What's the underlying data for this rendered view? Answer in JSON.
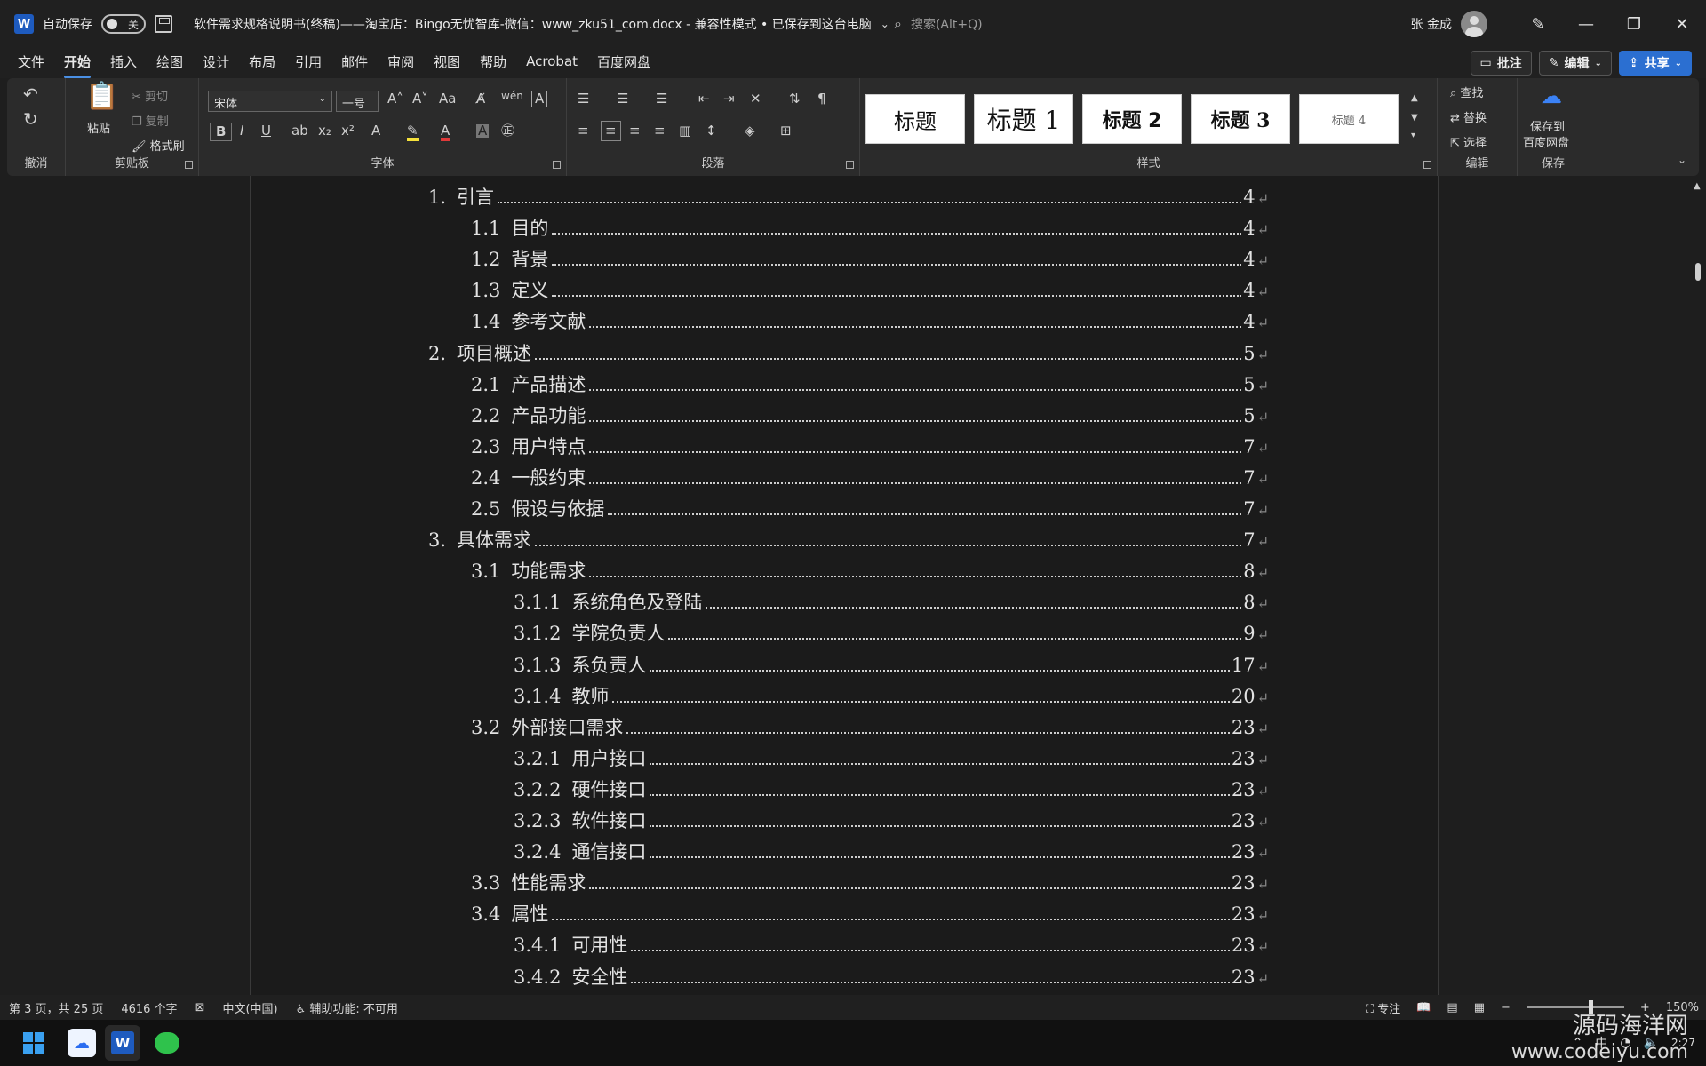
{
  "titlebar": {
    "autosave_label": "自动保存",
    "toggle_state": "关",
    "doc_title": "软件需求规格说明书(终稿)——淘宝店：Bingo无忧智库-微信：www_zku51_com.docx  -  兼容性模式 • 已保存到这台电脑",
    "search_placeholder": "搜索(Alt+Q)",
    "user_name": "张 金成"
  },
  "menu": {
    "tabs": [
      "文件",
      "开始",
      "插入",
      "绘图",
      "设计",
      "布局",
      "引用",
      "邮件",
      "审阅",
      "视图",
      "帮助",
      "Acrobat",
      "百度网盘"
    ],
    "active_tab": "开始",
    "comment_btn": "批注",
    "edit_btn": "编辑",
    "share_btn": "共享"
  },
  "ribbon": {
    "undo_label": "撤消",
    "clipboard": {
      "paste": "粘贴",
      "cut": "剪切",
      "copy": "复制",
      "format_painter": "格式刷",
      "label": "剪贴板"
    },
    "font": {
      "name": "宋体",
      "size": "一号",
      "label": "字体"
    },
    "paragraph_label": "段落",
    "styles": {
      "label": "样式",
      "items": [
        "标题",
        "标题 1",
        "标题 2",
        "标题 3",
        "标题 4"
      ]
    },
    "editing": {
      "find": "查找",
      "replace": "替换",
      "select": "选择",
      "label": "编辑"
    },
    "save": {
      "line1": "保存到",
      "line2": "百度网盘",
      "label": "保存"
    }
  },
  "toc": [
    {
      "num": "1.",
      "text": "引言",
      "page": "4",
      "level": 1
    },
    {
      "num": "1.1",
      "text": "目的",
      "page": "4",
      "level": 2
    },
    {
      "num": "1.2",
      "text": "背景",
      "page": "4",
      "level": 2
    },
    {
      "num": "1.3",
      "text": "定义",
      "page": "4",
      "level": 2
    },
    {
      "num": "1.4",
      "text": "参考文献",
      "page": "4",
      "level": 2
    },
    {
      "num": "2.",
      "text": "项目概述",
      "page": "5",
      "level": 1
    },
    {
      "num": "2.1",
      "text": "产品描述",
      "page": "5",
      "level": 2
    },
    {
      "num": "2.2",
      "text": "产品功能",
      "page": "5",
      "level": 2
    },
    {
      "num": "2.3",
      "text": "用户特点",
      "page": "7",
      "level": 2
    },
    {
      "num": "2.4",
      "text": "一般约束",
      "page": "7",
      "level": 2
    },
    {
      "num": "2.5",
      "text": "假设与依据",
      "page": "7",
      "level": 2
    },
    {
      "num": "3.",
      "text": "具体需求",
      "page": "7",
      "level": 1
    },
    {
      "num": "3.1",
      "text": "功能需求",
      "page": "8",
      "level": 2
    },
    {
      "num": "3.1.1",
      "text": "系统角色及登陆",
      "page": "8",
      "level": 3
    },
    {
      "num": "3.1.2",
      "text": "学院负责人",
      "page": "9",
      "level": 3
    },
    {
      "num": "3.1.3",
      "text": "系负责人",
      "page": "17",
      "level": 3
    },
    {
      "num": "3.1.4",
      "text": "教师",
      "page": "20",
      "level": 3
    },
    {
      "num": "3.2",
      "text": "外部接口需求",
      "page": "23",
      "level": 2
    },
    {
      "num": "3.2.1",
      "text": "用户接口",
      "page": "23",
      "level": 3
    },
    {
      "num": "3.2.2",
      "text": "硬件接口",
      "page": "23",
      "level": 3
    },
    {
      "num": "3.2.3",
      "text": "软件接口",
      "page": "23",
      "level": 3
    },
    {
      "num": "3.2.4",
      "text": "通信接口",
      "page": "23",
      "level": 3
    },
    {
      "num": "3.3",
      "text": "性能需求",
      "page": "23",
      "level": 2
    },
    {
      "num": "3.4",
      "text": "属性",
      "page": "23",
      "level": 2
    },
    {
      "num": "3.4.1",
      "text": "可用性",
      "page": "23",
      "level": 3
    },
    {
      "num": "3.4.2",
      "text": "安全性",
      "page": "23",
      "level": 3
    }
  ],
  "statusbar": {
    "page_info": "第 3 页，共 25 页",
    "word_count": "4616 个字",
    "language": "中文(中国)",
    "accessibility": "辅助功能: 不可用",
    "focus": "专注",
    "zoom": "150%"
  },
  "taskbar": {
    "clock_time": "2:27",
    "ime": "中"
  },
  "watermark": {
    "line1": "源码海洋网",
    "line2": "www.codeiyu.com"
  }
}
